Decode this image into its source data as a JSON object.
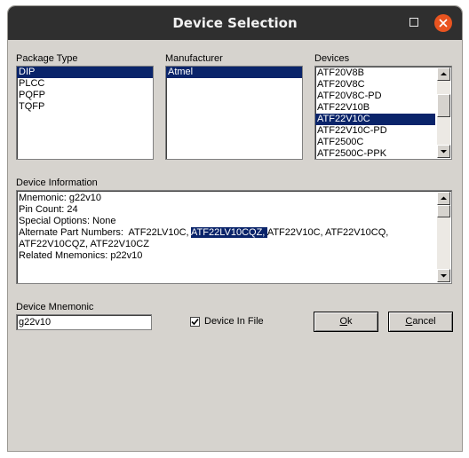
{
  "window": {
    "title": "Device Selection"
  },
  "package_type": {
    "label": "Package Type",
    "items": [
      "DIP",
      "PLCC",
      "PQFP",
      "TQFP"
    ],
    "selected": 0
  },
  "manufacturer": {
    "label": "Manufacturer",
    "items": [
      "Atmel"
    ],
    "selected": 0
  },
  "devices": {
    "label": "Devices",
    "items": [
      "ATF20V8B",
      "ATF20V8C",
      "ATF20V8C-PD",
      "ATF22V10B",
      "ATF22V10C",
      "ATF22V10C-PD",
      "ATF2500C",
      "ATF2500C-PPK"
    ],
    "selected": 4
  },
  "device_information": {
    "label": "Device Information",
    "mnemonic": "Mnemonic:  g22v10",
    "pin_count": "Pin Count:  24",
    "special_options": "Special Options:  None",
    "alt_prefix": "Alternate Part Numbers:  ATF22LV10C, ",
    "alt_highlight": "ATF22LV10CQZ, ",
    "alt_suffix": "ATF22V10C, ATF22V10CQ,",
    "alt_line2": "ATF22V10CQZ, ATF22V10CZ",
    "related": "Related Mnemonics:  p22v10"
  },
  "device_mnemonic": {
    "label": "Device Mnemonic",
    "value": "g22v10"
  },
  "device_in_file": {
    "label": "Device In File",
    "checked": true
  },
  "buttons": {
    "ok_mnemonic": "O",
    "ok_rest": "k",
    "cancel_mnemonic": "C",
    "cancel_rest": "ancel"
  }
}
